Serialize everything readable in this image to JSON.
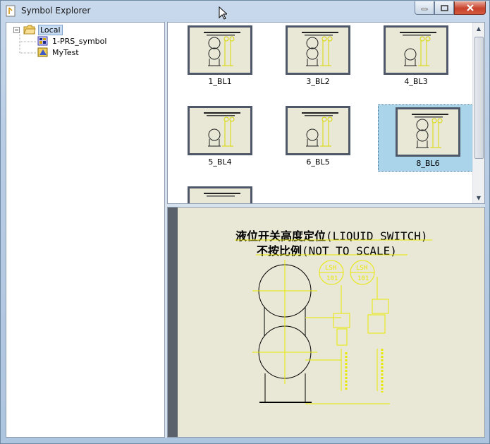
{
  "window": {
    "title": "Symbol Explorer",
    "buttons": {
      "minimize": "minimize-icon",
      "maximize": "maximize-icon",
      "close": "close-icon"
    }
  },
  "tree": {
    "root": {
      "label": "Local",
      "icon": "folder-open-icon",
      "expander": "collapse-icon"
    },
    "children": [
      {
        "label": "1-PRS_symbol",
        "icon": "symbol-library-icon"
      },
      {
        "label": "MyTest",
        "icon": "symbol-library-icon"
      }
    ]
  },
  "thumbnails": [
    {
      "label": "1_BL1",
      "variant": "double"
    },
    {
      "label": "3_BL2",
      "variant": "double"
    },
    {
      "label": "4_BL3",
      "variant": "single"
    },
    {
      "label": "5_BL4",
      "variant": "single"
    },
    {
      "label": "6_BL5",
      "variant": "single"
    },
    {
      "label": "8_BL6",
      "variant": "double",
      "selected": true
    },
    {
      "label": "",
      "variant": "partial"
    }
  ],
  "preview": {
    "title_cn": "液位开关高度定位",
    "title_en": "(LIQUID SWITCH)",
    "subtitle_cn": "不按比例",
    "subtitle_en": "(NOT TO SCALE)",
    "tag_1_top": "LSH",
    "tag_1_bottom": "101",
    "tag_2_top": "LSH",
    "tag_2_bottom": "101"
  },
  "colors": {
    "drawing_bg": "#e9e8d6",
    "drawing_yellow": "#e8e800",
    "frame": "#4f5868",
    "selection": "#a9d4e9"
  }
}
